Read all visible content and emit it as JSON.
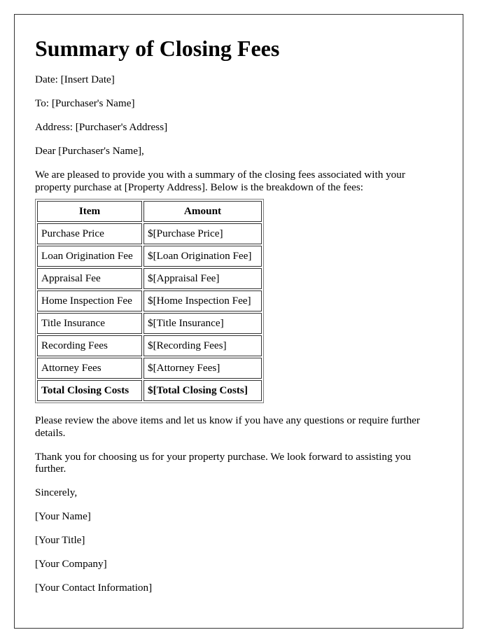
{
  "title": "Summary of Closing Fees",
  "header_lines": {
    "date": "Date: [Insert Date]",
    "to": "To: [Purchaser's Name]",
    "address": "Address: [Purchaser's Address]",
    "salutation": "Dear [Purchaser's Name],"
  },
  "intro": "We are pleased to provide you with a summary of the closing fees associated with your property purchase at [Property Address]. Below is the breakdown of the fees:",
  "fees_table": {
    "headers": [
      "Item",
      "Amount"
    ],
    "rows": [
      {
        "item": "Purchase Price",
        "amount": "$[Purchase Price]"
      },
      {
        "item": "Loan Origination Fee",
        "amount": "$[Loan Origination Fee]"
      },
      {
        "item": "Appraisal Fee",
        "amount": "$[Appraisal Fee]"
      },
      {
        "item": "Home Inspection Fee",
        "amount": "$[Home Inspection Fee]"
      },
      {
        "item": "Title Insurance",
        "amount": "$[Title Insurance]"
      },
      {
        "item": "Recording Fees",
        "amount": "$[Recording Fees]"
      },
      {
        "item": "Attorney Fees",
        "amount": "$[Attorney Fees]"
      }
    ],
    "total": {
      "item": "Total Closing Costs",
      "amount": "$[Total Closing Costs]"
    }
  },
  "review_note": "Please review the above items and let us know if you have any questions or require further details.",
  "thanks": "Thank you for choosing us for your property purchase. We look forward to assisting you further.",
  "closing": "Sincerely,",
  "signature": {
    "name": "[Your Name]",
    "title": "[Your Title]",
    "company": "[Your Company]",
    "contact": "[Your Contact Information]"
  }
}
